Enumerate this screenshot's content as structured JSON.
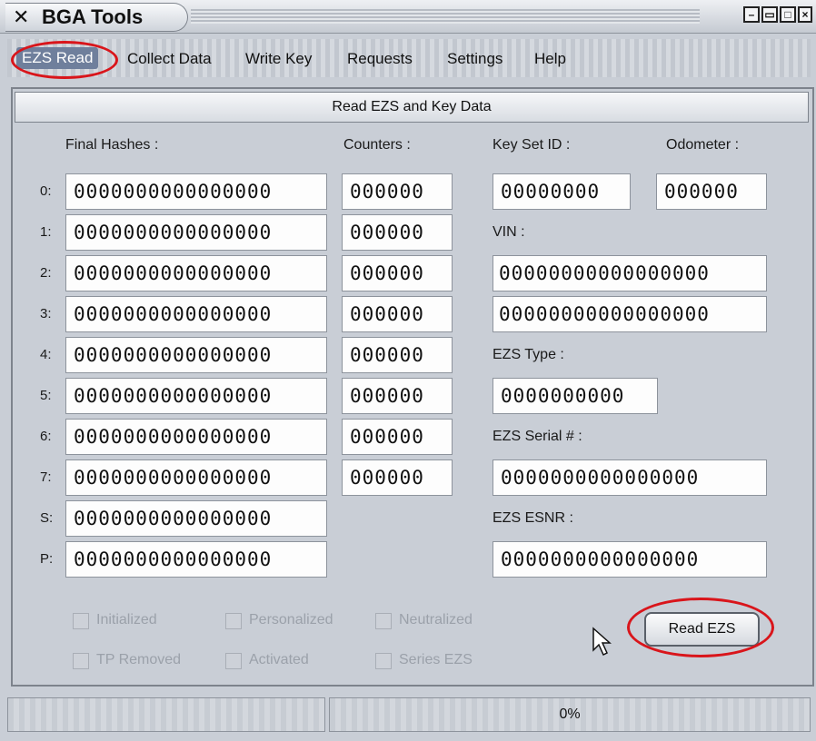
{
  "window": {
    "title": "BGA Tools",
    "icon": "bga-tools-logo-icon",
    "controls": [
      "minimize-icon",
      "restore-icon",
      "maximize-icon",
      "close-icon"
    ]
  },
  "menu": {
    "items": [
      {
        "label": "EZS Read",
        "active": true
      },
      {
        "label": "Collect Data"
      },
      {
        "label": "Write Key"
      },
      {
        "label": "Requests"
      },
      {
        "label": "Settings"
      },
      {
        "label": "Help"
      }
    ]
  },
  "panel": {
    "header": "Read EZS and Key Data",
    "final_hashes_label": "Final Hashes :",
    "counters_label": "Counters :",
    "key_set_id_label": "Key Set ID :",
    "odometer_label": "Odometer :",
    "vin_label": "VIN :",
    "ezs_type_label": "EZS Type :",
    "ezs_serial_label": "EZS Serial # :",
    "ezs_esnr_label": "EZS ESNR :",
    "rows": [
      {
        "label": "0:",
        "hash": "0000000000000000",
        "counter": "000000"
      },
      {
        "label": "1:",
        "hash": "0000000000000000",
        "counter": "000000"
      },
      {
        "label": "2:",
        "hash": "0000000000000000",
        "counter": "000000"
      },
      {
        "label": "3:",
        "hash": "0000000000000000",
        "counter": "000000"
      },
      {
        "label": "4:",
        "hash": "0000000000000000",
        "counter": "000000"
      },
      {
        "label": "5:",
        "hash": "0000000000000000",
        "counter": "000000"
      },
      {
        "label": "6:",
        "hash": "0000000000000000",
        "counter": "000000"
      },
      {
        "label": "7:",
        "hash": "0000000000000000",
        "counter": "000000"
      },
      {
        "label": "S:",
        "hash": "0000000000000000"
      },
      {
        "label": "P:",
        "hash": "0000000000000000"
      }
    ],
    "key_set_id": "00000000",
    "odometer": "000000",
    "vin_line1": "00000000000000000",
    "vin_line2": "00000000000000000",
    "ezs_type": "0000000000",
    "ezs_serial": "0000000000000000",
    "ezs_esnr": "0000000000000000",
    "checkboxes": [
      {
        "label": "Initialized",
        "checked": false
      },
      {
        "label": "Personalized",
        "checked": false
      },
      {
        "label": "Neutralized",
        "checked": false
      },
      {
        "label": "TP Removed",
        "checked": false
      },
      {
        "label": "Activated",
        "checked": false
      },
      {
        "label": "Series EZS",
        "checked": false
      }
    ],
    "read_button": "Read EZS"
  },
  "status": {
    "left": "",
    "progress": "0%"
  },
  "colors": {
    "annotation": "#d9151b",
    "window_bg": "#c9ced6",
    "menu_active_bg": "#6f7f9c"
  }
}
